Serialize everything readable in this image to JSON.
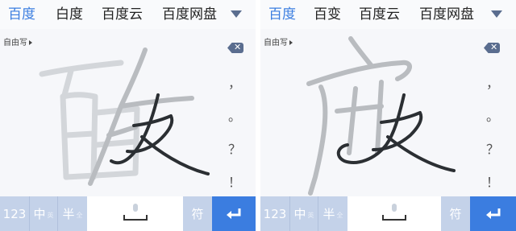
{
  "panels": [
    {
      "candidates": [
        "百度",
        "白度",
        "百度云",
        "百度网盘"
      ],
      "mode_label": "自由写",
      "punctuation": [
        "，",
        "。",
        "？",
        "！"
      ],
      "keys": {
        "num": "123",
        "zh": "中",
        "zh_sub": "英",
        "half": "半",
        "half_sub": "全",
        "symbol": "符"
      }
    },
    {
      "candidates": [
        "百度",
        "百变",
        "百度云",
        "百度网盘"
      ],
      "mode_label": "自由写",
      "punctuation": [
        "，",
        "。",
        "？",
        "！"
      ],
      "keys": {
        "num": "123",
        "zh": "中",
        "zh_sub": "英",
        "half": "半",
        "half_sub": "全",
        "symbol": "符"
      }
    }
  ],
  "colors": {
    "accent": "#3b7de0",
    "key_bg": "#c4d2e9",
    "ink_dark": "#2b2f33",
    "ink_light": "#c8cbcf"
  }
}
